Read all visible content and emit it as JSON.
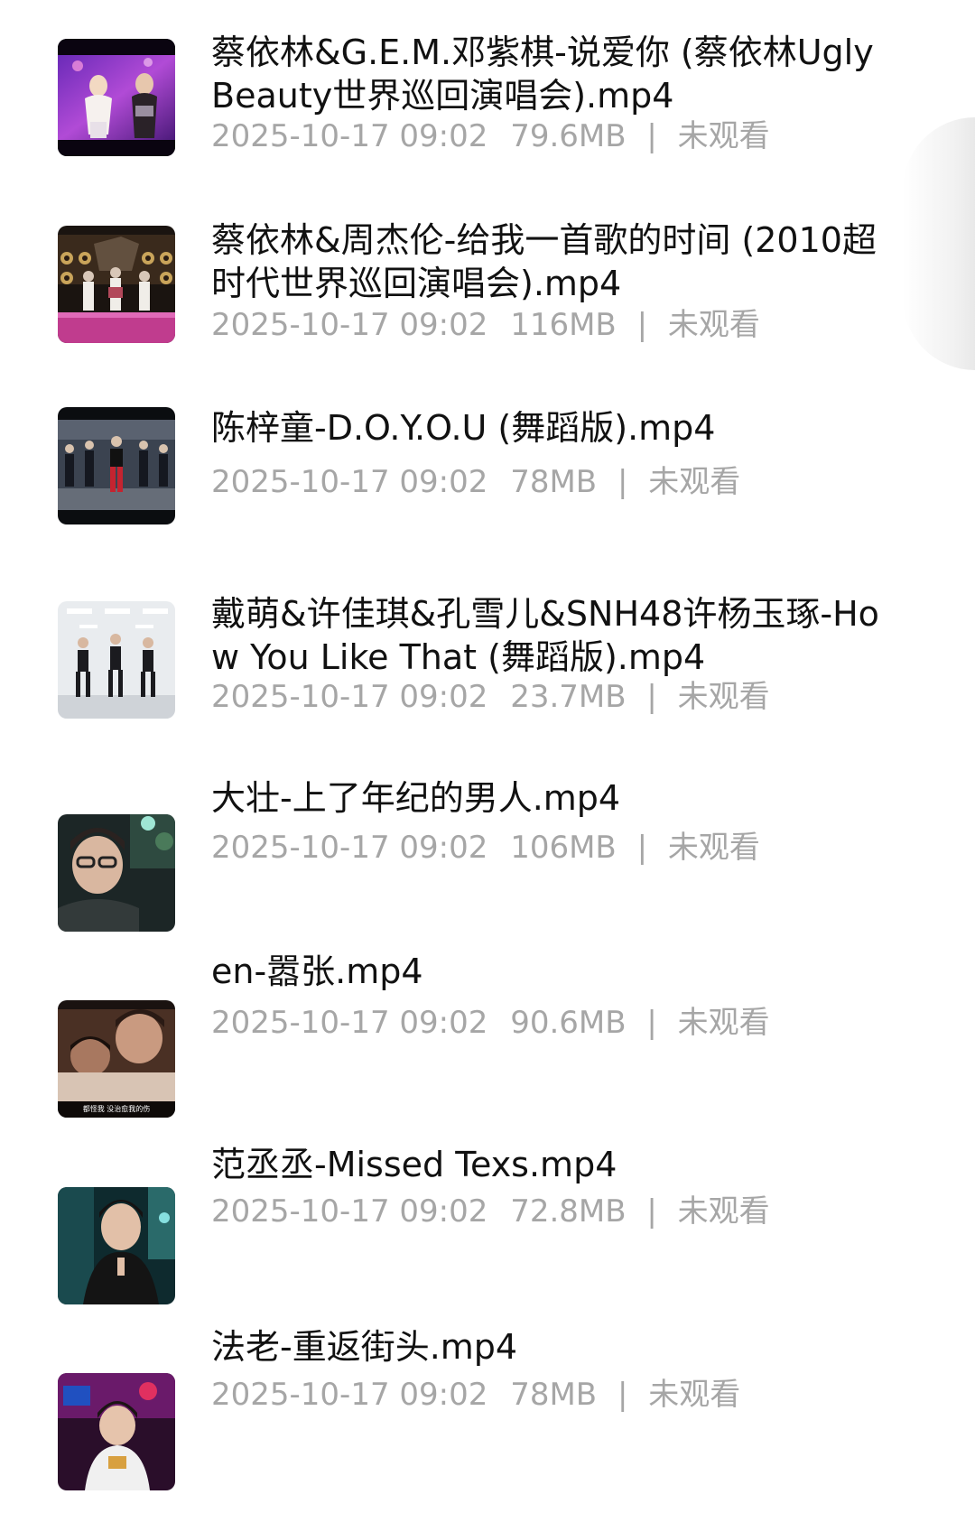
{
  "videos": [
    {
      "title": "蔡依林&G.E.M.邓紫棋-说爱你 (蔡依林Ugly Beauty世界巡回演唱会).mp4",
      "date": "2025-10-17 09:02",
      "size": "79.6MB",
      "separator": "|",
      "status": "未观看",
      "thumb_icon": "concert-stage-thumbnail"
    },
    {
      "title": "蔡依林&周杰伦-给我一首歌的时间 (2010超时代世界巡回演唱会).mp4",
      "date": "2025-10-17 09:02",
      "size": "116MB",
      "separator": "|",
      "status": "未观看",
      "thumb_icon": "concert-stage-thumbnail"
    },
    {
      "title": "陈梓童-D.O.Y.O.U (舞蹈版).mp4",
      "date": "2025-10-17 09:02",
      "size": "78MB",
      "separator": "|",
      "status": "未观看",
      "thumb_icon": "dance-performance-thumbnail"
    },
    {
      "title": "戴萌&许佳琪&孔雪儿&SNH48许杨玉琢-How You Like That (舞蹈版).mp4",
      "date": "2025-10-17 09:02",
      "size": "23.7MB",
      "separator": "|",
      "status": "未观看",
      "thumb_icon": "dance-studio-thumbnail"
    },
    {
      "title": "大壮-上了年纪的男人.mp4",
      "date": "2025-10-17 09:02",
      "size": "106MB",
      "separator": "|",
      "status": "未观看",
      "thumb_icon": "portrait-thumbnail"
    },
    {
      "title": "en-嚣张.mp4",
      "date": "2025-10-17 09:02",
      "size": "90.6MB",
      "separator": "|",
      "status": "未观看",
      "thumb_icon": "movie-scene-thumbnail",
      "thumb_caption": "都怪我 没治愈我的伤"
    },
    {
      "title": "范丞丞-Missed Texs.mp4",
      "date": "2025-10-17 09:02",
      "size": "72.8MB",
      "separator": "|",
      "status": "未观看",
      "thumb_icon": "portrait-thumbnail"
    },
    {
      "title": "法老-重返街头.mp4",
      "date": "2025-10-17 09:02",
      "size": "78MB",
      "separator": "|",
      "status": "未观看",
      "thumb_icon": "music-video-thumbnail"
    }
  ]
}
